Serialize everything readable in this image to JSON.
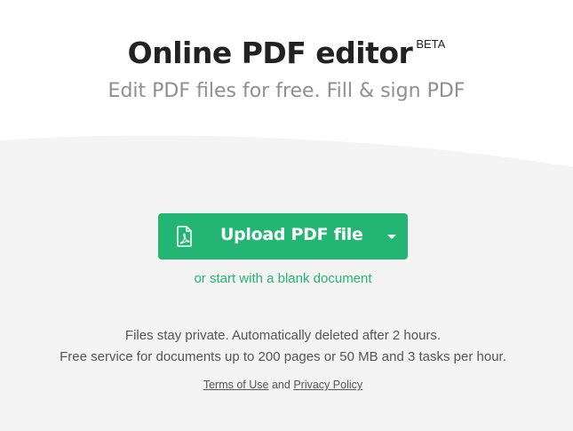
{
  "header": {
    "title": "Online PDF editor",
    "badge": "BETA",
    "subtitle": "Edit PDF files for free. Fill & sign PDF"
  },
  "upload": {
    "label": "Upload PDF file",
    "icon": "pdf-file-icon",
    "dropdown_icon": "caret-down-icon",
    "color": "#22b573"
  },
  "blank_link": "or start with a blank document",
  "info": {
    "line1": "Files stay private. Automatically deleted after 2 hours.",
    "line2": "Free service for documents up to 200 pages or 50 MB and 3 tasks per hour."
  },
  "legal": {
    "terms": "Terms of Use",
    "conjunction": "and",
    "privacy": "Privacy Policy"
  },
  "colors": {
    "background_top": "#ffffff",
    "background_bottom": "#f4f4f4",
    "title": "#222222",
    "subtitle": "#8f8f8f",
    "accent": "#22b573"
  }
}
